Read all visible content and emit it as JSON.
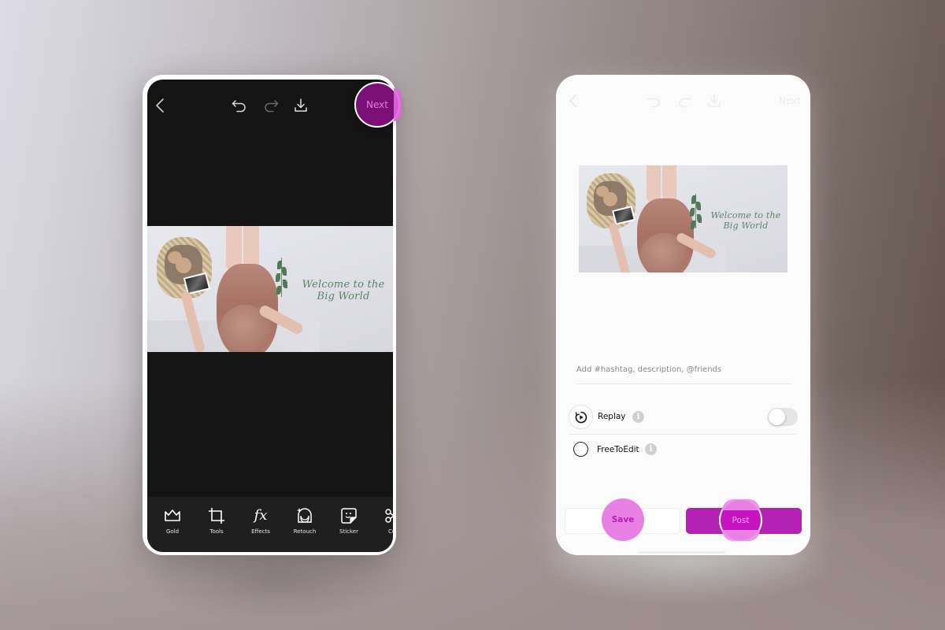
{
  "editor": {
    "top_bar": {
      "back_icon": "chevron-left-icon",
      "undo_icon": "undo-icon",
      "redo_icon": "redo-icon",
      "download_icon": "download-icon",
      "next_label": "Next"
    },
    "photo": {
      "caption_line1": "Welcome to the",
      "caption_line2": "Big World"
    },
    "tools": [
      {
        "label": "Gold",
        "icon": "crown-icon"
      },
      {
        "label": "Tools",
        "icon": "crop-icon"
      },
      {
        "label": "Effects",
        "icon": "fx-icon"
      },
      {
        "label": "Retouch",
        "icon": "face-retouch-icon"
      },
      {
        "label": "Sticker",
        "icon": "sticker-icon"
      },
      {
        "label": "Cut",
        "icon": "scissors-icon"
      }
    ],
    "fx_glyph": "fx"
  },
  "share": {
    "top_bar_ghost": {
      "next_label": "Next"
    },
    "photo": {
      "caption_line1": "Welcome to the",
      "caption_line2": "Big World"
    },
    "caption_placeholder": "Add #hashtag, description, @friends",
    "caption_value": "",
    "options": [
      {
        "label": "Replay",
        "icon": "replay-icon",
        "info_icon": "info-icon",
        "toggle_on": false
      },
      {
        "label": "FreeToEdit",
        "icon": "radio-unchecked-icon",
        "info_icon": "info-icon",
        "checked": false
      }
    ],
    "info_glyph": "i",
    "save_label": "Save",
    "post_label": "Post"
  },
  "colors": {
    "accent": "#b322b5",
    "next_button": "#7a0f78",
    "tap_highlight": "#e87ae4",
    "editor_background": "#141414",
    "toolbar_background": "#1f1f1f",
    "caption_text": "#5b8268"
  }
}
